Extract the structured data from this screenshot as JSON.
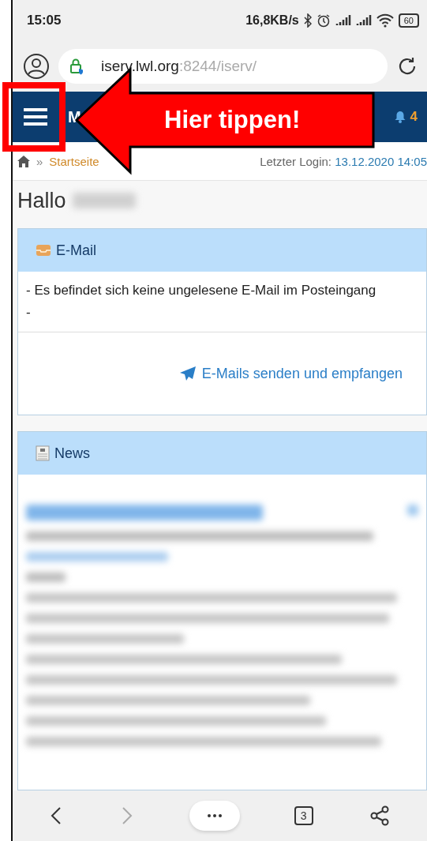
{
  "status_bar": {
    "time": "15:05",
    "speed": "16,8KB/s",
    "battery": "60"
  },
  "address_bar": {
    "host": "iserv.lwl.org",
    "path": ":8244/iserv/"
  },
  "header": {
    "title": "M",
    "notification_count": "4"
  },
  "breadcrumb": {
    "separator": "»",
    "current": "Startseite",
    "login_label": "Letzter Login:",
    "login_value": "13.12.2020 14:05"
  },
  "greeting": "Hallo",
  "email_card": {
    "title": "E-Mail",
    "lines": [
      "- Es befindet sich keine ungelesene E-Mail im Posteingang",
      "-"
    ],
    "link": "E-Mails senden und empfangen"
  },
  "news_card": {
    "title": "News"
  },
  "bottom_bar": {
    "forward_disabled": true,
    "tab_count": "3"
  },
  "annotation": {
    "text": "Hier tippen!"
  }
}
